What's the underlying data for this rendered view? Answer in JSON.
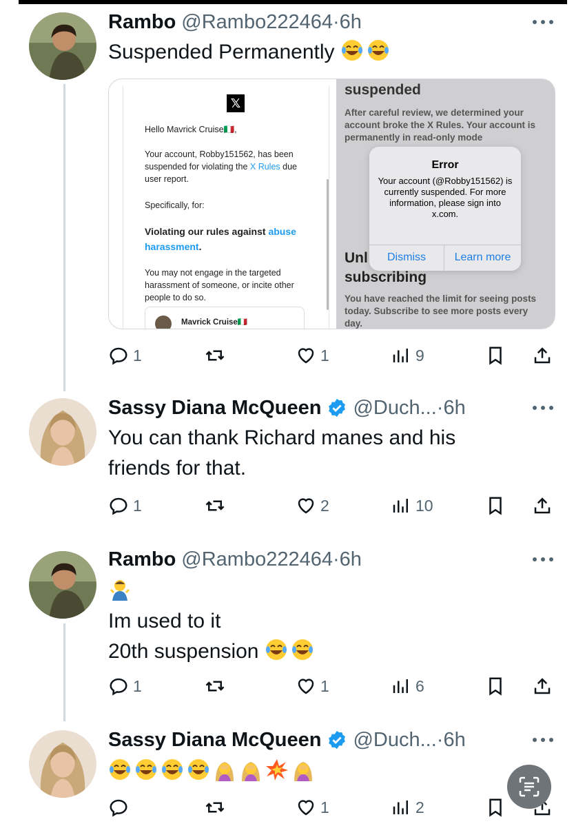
{
  "colors": {
    "text": "#0f1419",
    "secondary": "#536471",
    "verified": "#1d9bf0",
    "thread_line": "#cfd9de",
    "fab": "#6f7478"
  },
  "tweets": [
    {
      "name": "Rambo",
      "handle": "@Rambo222464",
      "time": "·6h",
      "verified": false,
      "text_lines": [
        "Suspended Permanently"
      ],
      "emoji_lines": [
        [
          "laughing-crying",
          "laughing-crying"
        ]
      ],
      "stats": {
        "replies": "1",
        "reposts": "",
        "likes": "1",
        "views": "9"
      }
    },
    {
      "name": "Sassy Diana McQueen",
      "handle": "@Duch...",
      "time": "·6h",
      "verified": true,
      "text_lines": [
        "You can thank Richard manes and his",
        "friends for that."
      ],
      "stats": {
        "replies": "1",
        "reposts": "",
        "likes": "2",
        "views": "10"
      }
    },
    {
      "name": "Rambo",
      "handle": "@Rambo222464",
      "time": "·6h",
      "verified": false,
      "text_lines": [
        "Im used to it",
        "20th suspension"
      ],
      "emoji_lines": [
        [
          "man-shrugging"
        ],
        [
          "laughing-crying",
          "laughing-crying"
        ]
      ],
      "stats": {
        "replies": "1",
        "reposts": "",
        "likes": "1",
        "views": "6"
      }
    },
    {
      "name": "Sassy Diana McQueen",
      "handle": "@Duch...",
      "time": "·6h",
      "verified": true,
      "emoji_lines": [
        [
          "laughing-crying",
          "laughing-crying",
          "laughing-crying",
          "laughing-crying",
          "woman-facepalming",
          "woman-facepalming",
          "collision",
          "woman-facepalming"
        ]
      ],
      "stats": {
        "replies": "",
        "reposts": "",
        "likes": "1",
        "views": "2"
      }
    }
  ],
  "media": {
    "left_email": {
      "greeting": "Hello Mavrick Cruise🇮🇹,",
      "body_prefix": "Your account, Robby151562, has been suspended for violating the ",
      "body_link": "X Rules",
      "body_suffix": " due",
      "body_line3": "user report.",
      "specifically": "Specifically, for:",
      "violation_prefix": "Violating our rules against ",
      "violation_link": "abuse",
      "violation_suffix": "harassment",
      "engage": "You may not engage in the targeted harassment of someone, or incite other people to do so.",
      "card_name": "Mavrick Cruise🇮🇹"
    },
    "right_screen": {
      "title": "suspended",
      "body": "After careful review, we determined your account broke the X Rules. Your account is permanently in read-only mode",
      "subtitle_1": "Unl",
      "subtitle_2": "subscribing",
      "footer": "You have reached the limit for seeing posts today. Subscribe to see more posts every day."
    },
    "alert": {
      "title": "Error",
      "message": "Your account (@Robby151562) is currently suspended. For more information, please sign into x.com.",
      "dismiss": "Dismiss",
      "learn_more": "Learn more"
    }
  }
}
